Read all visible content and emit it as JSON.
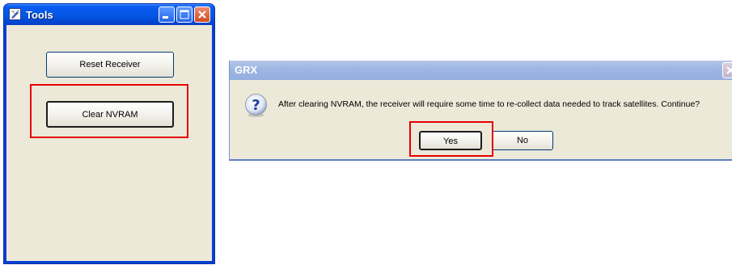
{
  "tools_window": {
    "title": "Tools",
    "buttons": {
      "reset_receiver": "Reset Receiver",
      "clear_nvram": "Clear NVRAM"
    }
  },
  "grx_dialog": {
    "title": "GRX",
    "message": "After clearing NVRAM, the receiver will require some time to re-collect data needed to track satellites. Continue?",
    "yes_label": "Yes",
    "no_label": "No",
    "icon": "question-icon"
  },
  "colors": {
    "highlight": "#e60000",
    "xp_title_blue": "#0458e5",
    "dialog_background": "#ece9d8"
  }
}
